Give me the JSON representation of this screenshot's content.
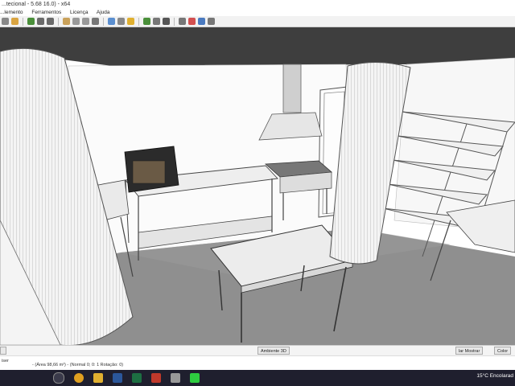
{
  "window": {
    "title": "...tecional - 5.68 16.0) - x64"
  },
  "menu": [
    "...lemento",
    "Ferramentos",
    "Licença",
    "Ajuda"
  ],
  "toolbar_icons": [
    "select-icon",
    "pan-icon",
    "zoom-icon",
    "undo-icon",
    "redo-icon",
    "cut-icon",
    "copy-icon",
    "paste-icon",
    "wall-icon",
    "room-icon",
    "door-icon",
    "window-icon",
    "furniture-icon",
    "text-icon",
    "dimension-icon",
    "compass-icon",
    "camera-icon",
    "render-icon",
    "3d-view-icon"
  ],
  "status_buttons": {
    "left_label": "",
    "ambiente_3d": "Ambiente 3D",
    "mostrar": "lar Mostrar",
    "color": "Color"
  },
  "info": {
    "left": "iser",
    "area": "- (Área 98,66 m²) - (Normal 0; 0: 1 Rotação: 0)"
  },
  "taskbar": {
    "weather": "15°C  Encolarad",
    "apps": [
      "search-icon",
      "task-view-icon",
      "chrome-icon",
      "explorer-icon",
      "word-icon",
      "excel-icon",
      "red-app-icon",
      "gear-app-icon",
      "green-app-icon"
    ]
  }
}
